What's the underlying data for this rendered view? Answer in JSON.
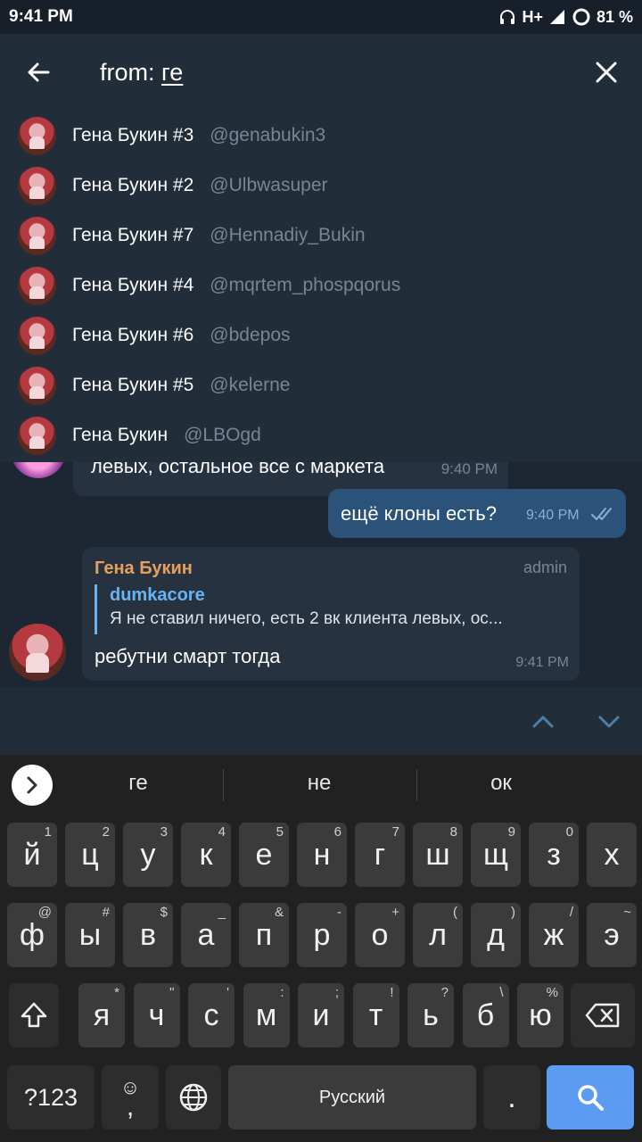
{
  "status_bar": {
    "time": "9:41 PM",
    "network": "H+",
    "battery": "81 %"
  },
  "search": {
    "prefix": "from: ",
    "term": "ге"
  },
  "mentions": [
    {
      "name": "Гена Букин #3",
      "username": "@genabukin3"
    },
    {
      "name": "Гена Букин #2",
      "username": "@Ulbwasuper"
    },
    {
      "name": "Гена Букин #7",
      "username": "@Hennadiy_Bukin"
    },
    {
      "name": "Гена Букин #4",
      "username": "@mqrtem_phospqorus"
    },
    {
      "name": "Гена Букин #6",
      "username": "@bdepos"
    },
    {
      "name": "Гена Букин #5",
      "username": "@kelerne"
    },
    {
      "name": "Гена Букин",
      "username": "@LBOgd"
    }
  ],
  "chat": {
    "partial_message": {
      "text": "левых, остальное все с маркета",
      "time": "9:40 PM"
    },
    "outgoing": {
      "text": "ещё клоны есть?",
      "time": "9:40 PM"
    },
    "incoming": {
      "sender": "Гена Букин",
      "role": "admin",
      "reply_to_name": "dumkacore",
      "reply_to_text": "Я не ставил ничего, есть 2 вк клиента левых, ос...",
      "text": "ребутни смарт тогда",
      "time": "9:41 PM"
    }
  },
  "keyboard": {
    "suggestions": [
      "ге",
      "не",
      "ок"
    ],
    "row1": [
      {
        "k": "й",
        "h": "1"
      },
      {
        "k": "ц",
        "h": "2"
      },
      {
        "k": "у",
        "h": "3"
      },
      {
        "k": "к",
        "h": "4"
      },
      {
        "k": "е",
        "h": "5"
      },
      {
        "k": "н",
        "h": "6"
      },
      {
        "k": "г",
        "h": "7"
      },
      {
        "k": "ш",
        "h": "8"
      },
      {
        "k": "щ",
        "h": "9"
      },
      {
        "k": "з",
        "h": "0"
      },
      {
        "k": "х",
        "h": ""
      }
    ],
    "row2": [
      {
        "k": "ф",
        "h": "@"
      },
      {
        "k": "ы",
        "h": "#"
      },
      {
        "k": "в",
        "h": "$"
      },
      {
        "k": "а",
        "h": "_"
      },
      {
        "k": "п",
        "h": "&"
      },
      {
        "k": "р",
        "h": "-"
      },
      {
        "k": "о",
        "h": "+"
      },
      {
        "k": "л",
        "h": "("
      },
      {
        "k": "д",
        "h": ")"
      },
      {
        "k": "ж",
        "h": "/"
      },
      {
        "k": "э",
        "h": "~"
      }
    ],
    "row3": [
      {
        "k": "я",
        "h": "*"
      },
      {
        "k": "ч",
        "h": "\""
      },
      {
        "k": "с",
        "h": "'"
      },
      {
        "k": "м",
        "h": ":"
      },
      {
        "k": "и",
        "h": ";"
      },
      {
        "k": "т",
        "h": "!"
      },
      {
        "k": "ь",
        "h": "?"
      },
      {
        "k": "б",
        "h": "\\"
      },
      {
        "k": "ю",
        "h": "%"
      }
    ],
    "symbols_label": "?123",
    "emoji_label": "☺",
    "comma_label": ",",
    "space_label": "Русский",
    "period_label": "."
  }
}
